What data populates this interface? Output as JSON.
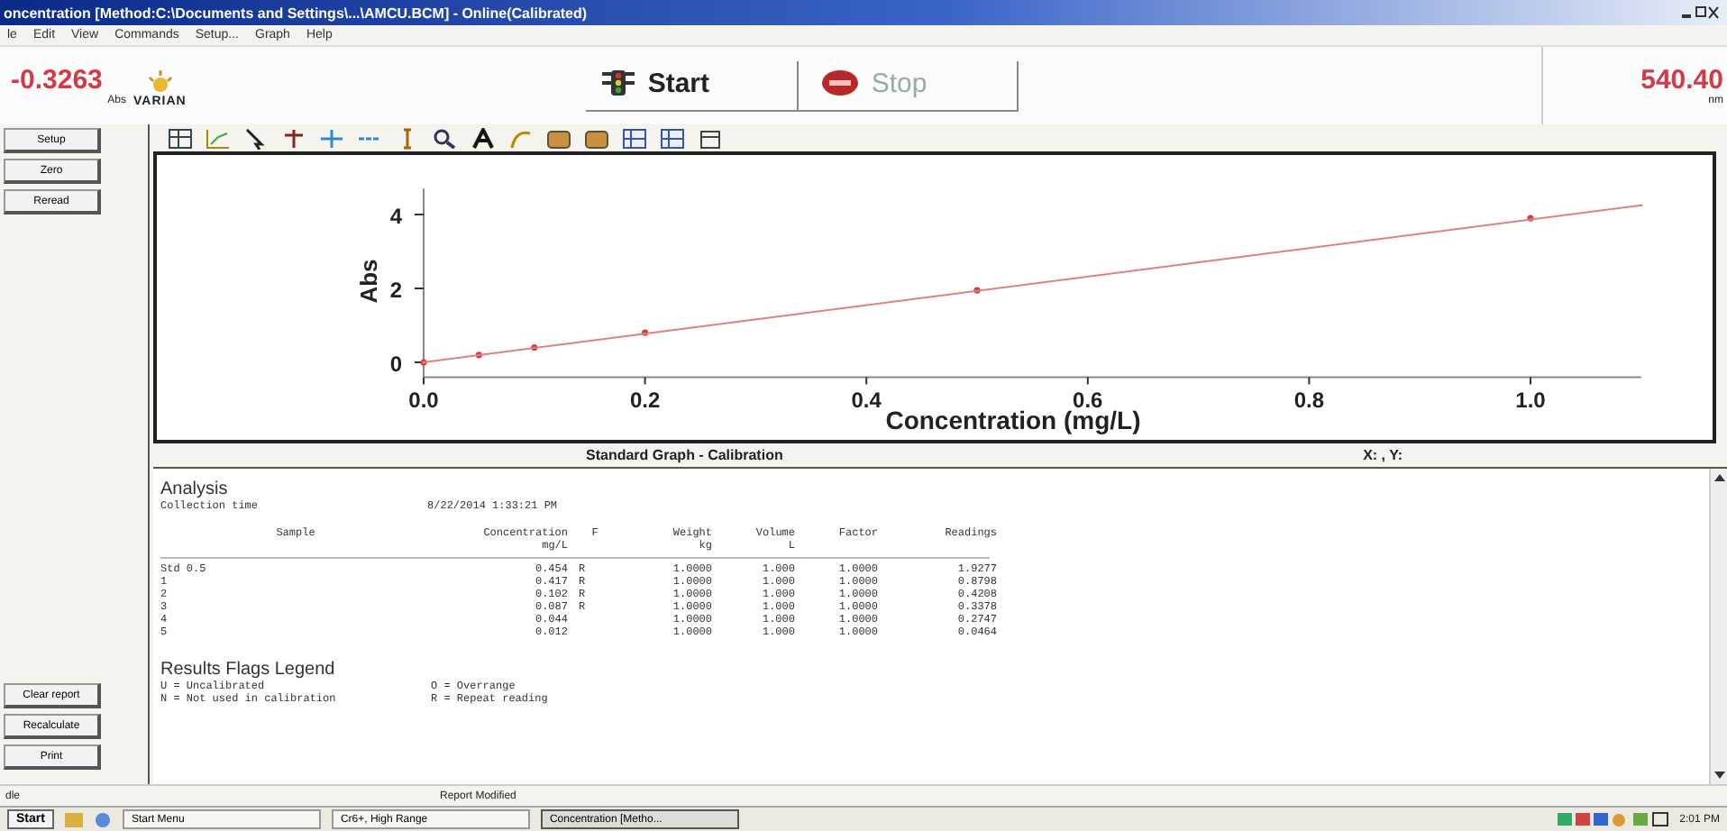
{
  "window": {
    "title": "oncentration [Method:C:\\Documents and Settings\\...\\AMCU.BCM] - Online(Calibrated)"
  },
  "menu": [
    "le",
    "Edit",
    "View",
    "Commands",
    "Setup...",
    "Graph",
    "Help"
  ],
  "reading": {
    "value": "-0.3263",
    "unit": "Abs"
  },
  "brand": "VARIAN",
  "run_buttons": [
    {
      "label": "Start",
      "kind": "start",
      "disabled": false
    },
    {
      "label": "Stop",
      "kind": "stop",
      "disabled": true
    }
  ],
  "wavelength": {
    "value": "540.40",
    "unit": "nm"
  },
  "side_buttons_top": [
    "Setup",
    "Zero",
    "Reread"
  ],
  "side_buttons_bottom": [
    "Clear report",
    "Recalculate",
    "Print"
  ],
  "graph": {
    "caption": "Standard Graph - Calibration",
    "cursor": "X: , Y:",
    "chart_data": {
      "type": "scatter",
      "xlabel": "Concentration (mg/L)",
      "ylabel": "Abs",
      "xlim": [
        0,
        1.1
      ],
      "ylim": [
        -0.4,
        4.7
      ],
      "xticks": [
        {
          "value": 0,
          "label": "0.0"
        },
        {
          "value": 0.2,
          "label": "0.2"
        },
        {
          "value": 0.4,
          "label": "0.4"
        },
        {
          "value": 0.6,
          "label": "0.6"
        },
        {
          "value": 0.8,
          "label": "0.8"
        },
        {
          "value": 1,
          "label": "1.0"
        }
      ],
      "yticks": [
        0,
        2,
        4
      ],
      "series": [
        {
          "type": "scatter",
          "color": "#d04040",
          "x": [
            0,
            0.05,
            0.1,
            0.2,
            0.5,
            1.0
          ],
          "values": [
            0,
            0.2,
            0.4,
            0.8,
            1.95,
            3.9
          ]
        },
        {
          "type": "line",
          "color": "#e08080",
          "x": [
            0,
            1.1
          ],
          "values": [
            0,
            4.25
          ]
        }
      ]
    }
  },
  "report": {
    "heading": "Analysis",
    "collection_label": "Collection time",
    "collection_value": "8/22/2014 1:33:21 PM",
    "columns": [
      {
        "label": "Sample"
      },
      {
        "label": "Concentration",
        "unit": "mg/L"
      },
      {
        "label": "F"
      },
      {
        "label": "Weight",
        "unit": "kg"
      },
      {
        "label": "Volume",
        "unit": "L"
      },
      {
        "label": "Factor"
      },
      {
        "label": "Readings"
      }
    ],
    "rows": [
      [
        "Std 0.5",
        "0.454",
        "R",
        "1.0000",
        "1.000",
        "1.0000",
        "1.9277"
      ],
      [
        "1",
        "0.417",
        "R",
        "1.0000",
        "1.000",
        "1.0000",
        "0.8798"
      ],
      [
        "2",
        "0.102",
        "R",
        "1.0000",
        "1.000",
        "1.0000",
        "0.4208"
      ],
      [
        "3",
        "0.087",
        "R",
        "1.0000",
        "1.000",
        "1.0000",
        "0.3378"
      ],
      [
        "4",
        "0.044",
        "",
        "1.0000",
        "1.000",
        "1.0000",
        "0.2747"
      ],
      [
        "5",
        "0.012",
        "",
        "1.0000",
        "1.000",
        "1.0000",
        "0.0464"
      ]
    ],
    "legend_title": "Results Flags Legend",
    "legend": [
      "U = Uncalibrated",
      "O = Overrange",
      "N = Not used in calibration",
      "R = Repeat reading"
    ]
  },
  "status_bar": {
    "left": "dle",
    "center": "Report Modified"
  },
  "taskbar": {
    "start": "Start",
    "tasks": [
      {
        "label": "Start Menu",
        "selected": false
      },
      {
        "label": "Cr6+, High Range",
        "selected": false
      },
      {
        "label": "Concentration [Metho...",
        "selected": true
      }
    ],
    "clock": "2:01 PM"
  }
}
